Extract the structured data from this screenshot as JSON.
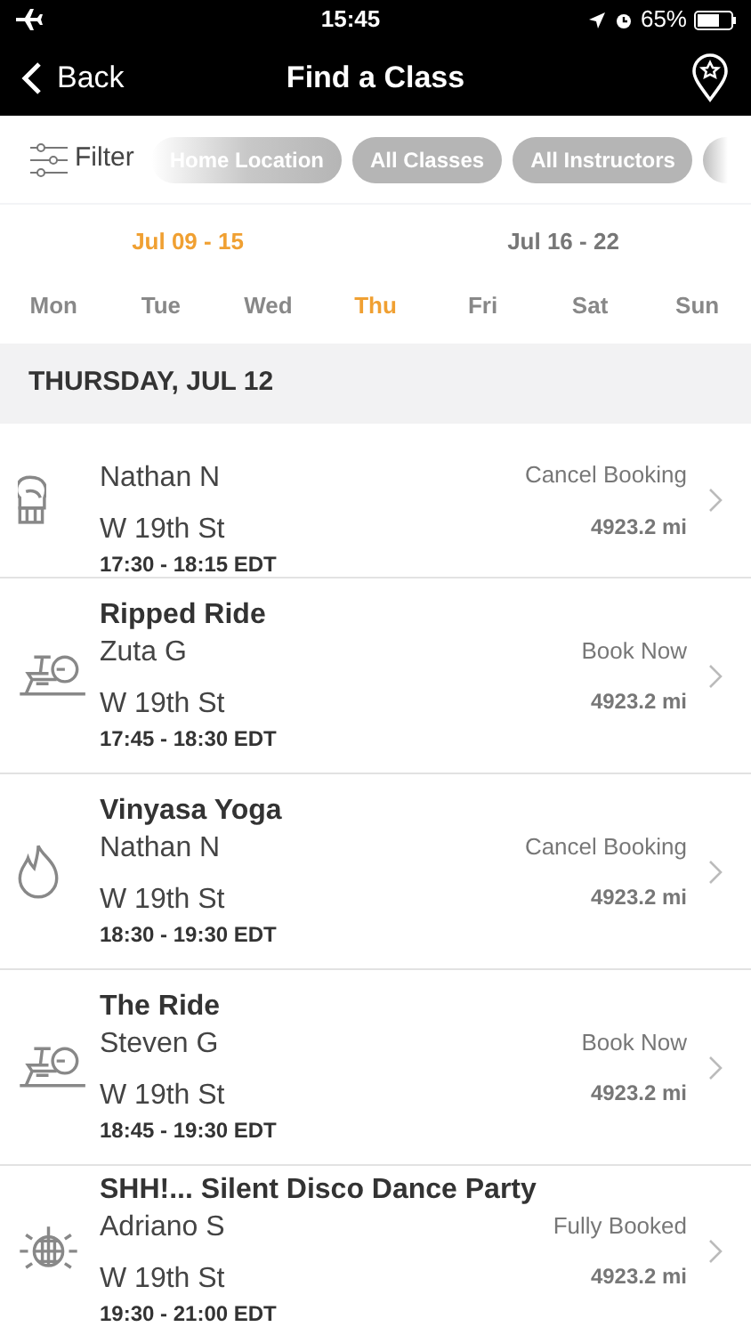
{
  "status_bar": {
    "time": "15:45",
    "battery": "65%"
  },
  "nav": {
    "back": "Back",
    "title": "Find a Class"
  },
  "filter": {
    "label": "Filter",
    "chips": [
      {
        "label": "Home Location",
        "faded": true
      },
      {
        "label": "All Classes",
        "faded": false
      },
      {
        "label": "All Instructors",
        "faded": false
      }
    ]
  },
  "weeks": [
    {
      "label": "Jul 09 - 15",
      "selected": true
    },
    {
      "label": "Jul 16 - 22",
      "selected": false
    }
  ],
  "days": [
    {
      "label": "Mon",
      "selected": false
    },
    {
      "label": "Tue",
      "selected": false
    },
    {
      "label": "Wed",
      "selected": false
    },
    {
      "label": "Thu",
      "selected": true
    },
    {
      "label": "Fri",
      "selected": false
    },
    {
      "label": "Sat",
      "selected": false
    },
    {
      "label": "Sun",
      "selected": false
    }
  ],
  "section_header": "THURSDAY, JUL 12",
  "classes": [
    {
      "kind": "boxing",
      "instructor": "Nathan N",
      "location": "W 19th St",
      "time": "17:30 - 18:15 EDT",
      "action": "Cancel Booking",
      "distance": "4923.2 mi"
    },
    {
      "kind": "cycling",
      "title": "Ripped Ride",
      "instructor": "Zuta G",
      "location": "W 19th St",
      "time": "17:45 - 18:30 EDT",
      "action": "Book Now",
      "distance": "4923.2 mi"
    },
    {
      "kind": "yoga",
      "title": "Vinyasa Yoga",
      "instructor": "Nathan N",
      "location": "W 19th St",
      "time": "18:30 - 19:30 EDT",
      "action": "Cancel Booking",
      "distance": "4923.2 mi"
    },
    {
      "kind": "cycling",
      "title": "The Ride",
      "instructor": "Steven G",
      "location": "W 19th St",
      "time": "18:45 - 19:30 EDT",
      "action": "Book Now",
      "distance": "4923.2 mi"
    },
    {
      "kind": "dance",
      "title": "SHH!... Silent Disco Dance Party",
      "instructor": "Adriano S",
      "location": "W 19th St",
      "time": "19:30 - 21:00 EDT",
      "action": "Fully Booked",
      "distance": "4923.2 mi"
    }
  ]
}
